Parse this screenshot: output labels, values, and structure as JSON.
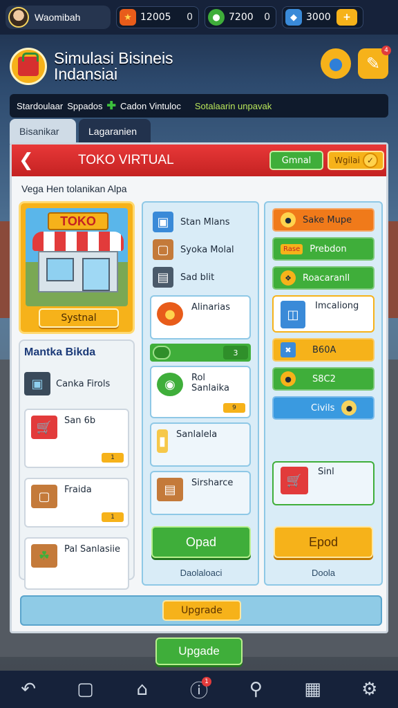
{
  "topbar": {
    "username": "Waomibah",
    "resources": [
      {
        "icon": "fire-shield-icon",
        "value": "12005",
        "sub": "0",
        "color": "#e85c1a"
      },
      {
        "icon": "green-coin-icon",
        "value": "7200",
        "sub": "0",
        "color": "#3fae3a"
      },
      {
        "icon": "blue-gem-icon",
        "value": "3000",
        "sub": "",
        "color": "#3a8ad8"
      }
    ]
  },
  "header": {
    "title_line1": "Simulasi Bisineis",
    "title_line2": "Indansiai",
    "edit_badge": "4"
  },
  "strip": {
    "text1": "Stardoulaar",
    "text2": "Sppados",
    "text3": "Cadon Vintuloc",
    "highlight": "Sotalaarin unpavak"
  },
  "tabs": [
    {
      "label": "Bisanikar"
    },
    {
      "label": "Lagaranien"
    }
  ],
  "panel": {
    "title": "TOKO VIRTUAL",
    "btn_green": "Gmnal",
    "btn_yellow": "Wgilai",
    "subtitle": "Vega Hen tolanikan Alpa",
    "shop": {
      "sign": "TOKO",
      "button": "Systnal"
    },
    "left_list": {
      "title": "Mantka Bikda",
      "items": [
        {
          "label": "Canka Firols"
        },
        {
          "label": "San 6b",
          "tag": "1"
        },
        {
          "label": "Fraida",
          "tag": "1"
        },
        {
          "label": "Pal Sanlasiie"
        }
      ]
    },
    "mid_list": {
      "rows": [
        {
          "label": "Stan Mlans"
        },
        {
          "label": "Syoka Molal"
        },
        {
          "label": "Sad blit"
        }
      ],
      "boxes": [
        {
          "label": "Alinarias"
        },
        {
          "label": "Rol Sanlaika",
          "tag": "9"
        },
        {
          "label": "Sanlalela"
        },
        {
          "label": "Sirsharce"
        }
      ],
      "bar_num": "3",
      "button": "Opad",
      "footer": "Daolaloaci"
    },
    "right_list": {
      "pills": [
        {
          "label": "Sake Mupe",
          "bg": "#f07a1a"
        },
        {
          "label": "Prebdon",
          "badge": "Rase",
          "bg": "#3fae3a"
        },
        {
          "label": "Roacaranll",
          "bg": "#3fae3a"
        }
      ],
      "box": {
        "label": "Imcaliong"
      },
      "pills2": [
        {
          "label": "B60A",
          "bg": "#f6b21a"
        },
        {
          "label": "S8C2",
          "bg": "#3fae3a"
        },
        {
          "label": "Civils",
          "bg": "#3a9ae0"
        }
      ],
      "cart": {
        "label": "Sinl"
      },
      "button": "Epod",
      "footer": "Doola"
    },
    "bottom_button": "Upgrade"
  },
  "main_button": "Upgade",
  "nav": {
    "items": [
      "back-icon",
      "square-icon",
      "home-icon",
      "alert-icon",
      "profile-icon",
      "shop-icon",
      "gear-icon"
    ],
    "alert_badge": "1"
  }
}
